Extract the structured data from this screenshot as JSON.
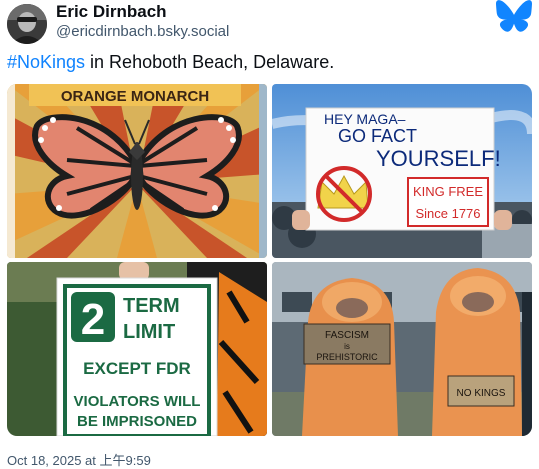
{
  "author": {
    "display_name": "Eric Dirnbach",
    "handle": "@ericdirnbach.bsky.social",
    "avatar_icon": "profile-photo-avatar"
  },
  "platform_icon": "bluesky-butterfly-icon",
  "post": {
    "hashtag": "#NoKings",
    "text": " in Rehoboth Beach, Delaware."
  },
  "images": {
    "monarch_sign": {
      "text": "ORANGE MONARCH"
    },
    "maga_sign": {
      "line1": "HEY MAGA–",
      "line2": "GO FACT",
      "line3": "YOURSELF!",
      "corner_line1": "KING FREE",
      "corner_line2": "Since 1776"
    },
    "term_limit_sign": {
      "number": "2",
      "line1": "TERM",
      "line2": "LIMIT",
      "line3": "EXCEPT FDR",
      "line4": "VIOLATORS WILL",
      "line5": "BE IMPRISONED"
    },
    "dino_signs": {
      "left_line1": "FASCISM",
      "left_line2": "is",
      "left_line3": "PREHISTORIC",
      "right": "NO KINGS"
    }
  },
  "timestamp": "Oct 18, 2025 at 上午9:59",
  "colors": {
    "name": "#0b0f14",
    "handle": "#42576c",
    "hashtag": "#1083fe",
    "bluesky": "#1185fe"
  }
}
